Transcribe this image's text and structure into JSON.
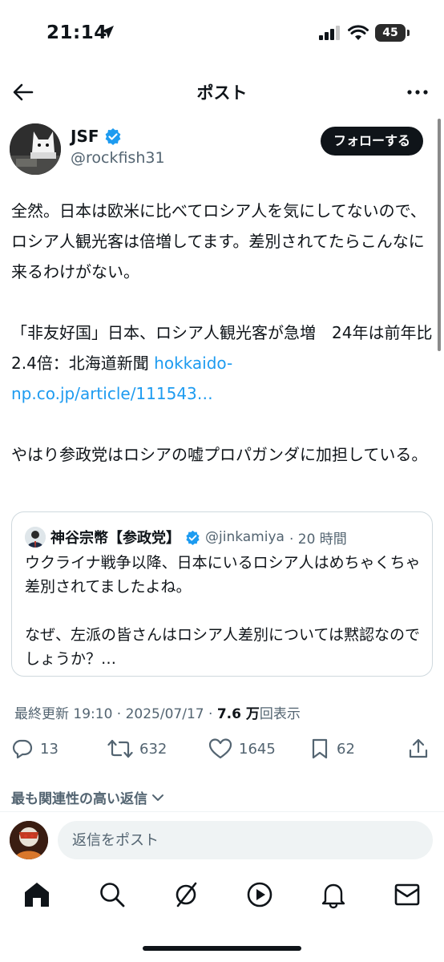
{
  "status_bar": {
    "time": "21:14",
    "battery": "45"
  },
  "header": {
    "title": "ポスト"
  },
  "post": {
    "author_name": "JSF",
    "author_handle": "@rockfish31",
    "follow_label": "フォローする",
    "paragraphs": [
      "全然。日本は欧米に比べてロシア人を気にしてないので、ロシア人観光客は倍増してます。差別されてたらこんなに来るわけがない。",
      "「非友好国」日本、ロシア人観光客が急増　24年は前年比2.4倍：北海道新聞 ",
      "やはり参政党はロシアの嘘プロパガンダに加担している。"
    ],
    "link_text": "hokkaido-np.co.jp/article/111543…"
  },
  "quote": {
    "name": "神谷宗幣【参政党】",
    "handle": "@jinkamiya",
    "time": "· 20 時間",
    "paragraphs": [
      "ウクライナ戦争以降、日本にいるロシア人はめちゃくちゃ差別されてましたよね。",
      "なぜ、左派の皆さんはロシア人差別については黙認なのでしょうか？…"
    ]
  },
  "meta": {
    "updated_label": "最終更新 19:10 · 2025/07/17 · ",
    "views": "7.6 万",
    "views_label": "回表示"
  },
  "actions": {
    "replies": "13",
    "reposts": "632",
    "likes": "1645",
    "bookmarks": "62"
  },
  "relevant_replies": "最も関連性の高い返信",
  "reply": {
    "placeholder": "返信をポスト"
  },
  "colors": {
    "text": "#0f1419",
    "secondary": "#536471",
    "link": "#1d9bf0",
    "verified": "#1d9bf0"
  },
  "icons": [
    "back-arrow-icon",
    "more-icon",
    "verified-icon",
    "reply-icon",
    "repost-icon",
    "like-icon",
    "bookmark-icon",
    "share-icon",
    "chevron-down-icon",
    "home-icon",
    "search-icon",
    "grok-icon",
    "video-icon",
    "bell-icon",
    "mail-icon"
  ]
}
